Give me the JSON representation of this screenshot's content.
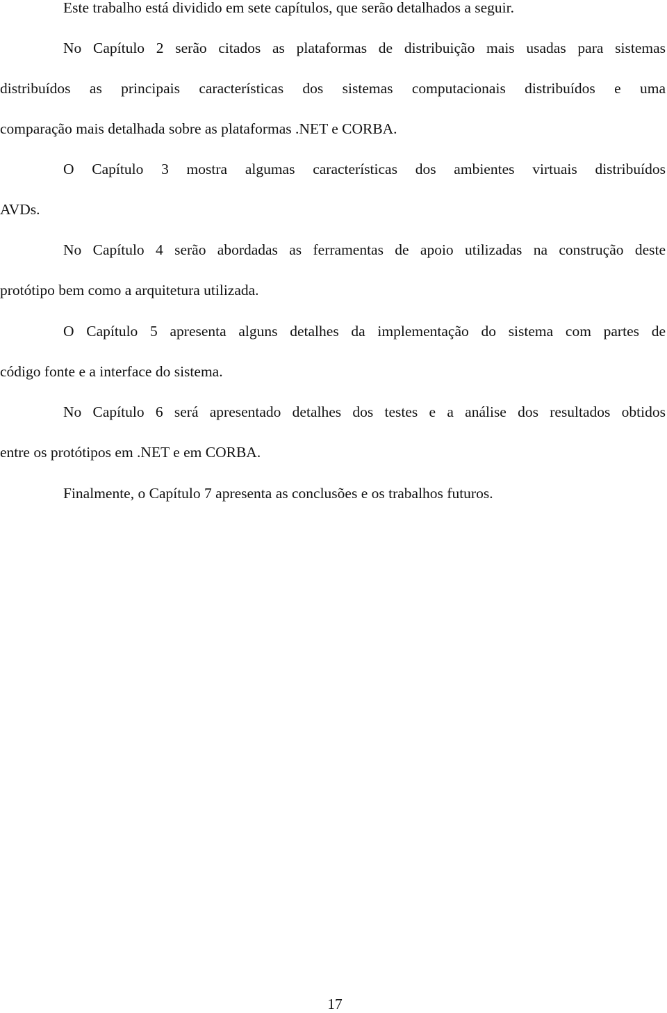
{
  "document": {
    "paragraphs": [
      {
        "lines": [
          "Este trabalho está dividido em sete capítulos, que serão detalhados a seguir."
        ]
      },
      {
        "lines": [
          "No Capítulo 2 serão citados as plataformas de distribuição mais usadas para sistemas",
          "distribuídos as principais características dos sistemas computacionais distribuídos e uma",
          "comparação mais detalhada sobre as plataformas .NET e CORBA."
        ]
      },
      {
        "lines": [
          "O Capítulo 3 mostra algumas características dos ambientes virtuais distribuídos",
          "AVDs."
        ]
      },
      {
        "lines": [
          "No Capítulo 4 serão abordadas as ferramentas de apoio utilizadas na construção deste",
          "protótipo bem como a arquitetura utilizada."
        ]
      },
      {
        "lines": [
          "O Capítulo 5 apresenta alguns detalhes da implementação do sistema com partes de",
          "código fonte e a interface do sistema."
        ]
      },
      {
        "lines": [
          "No Capítulo 6 será apresentado detalhes dos testes e a análise dos resultados obtidos",
          "entre os protótipos em .NET e  em CORBA."
        ]
      },
      {
        "lines": [
          "Finalmente, o Capítulo 7 apresenta as conclusões e os trabalhos futuros."
        ]
      }
    ],
    "page_number": "17"
  }
}
